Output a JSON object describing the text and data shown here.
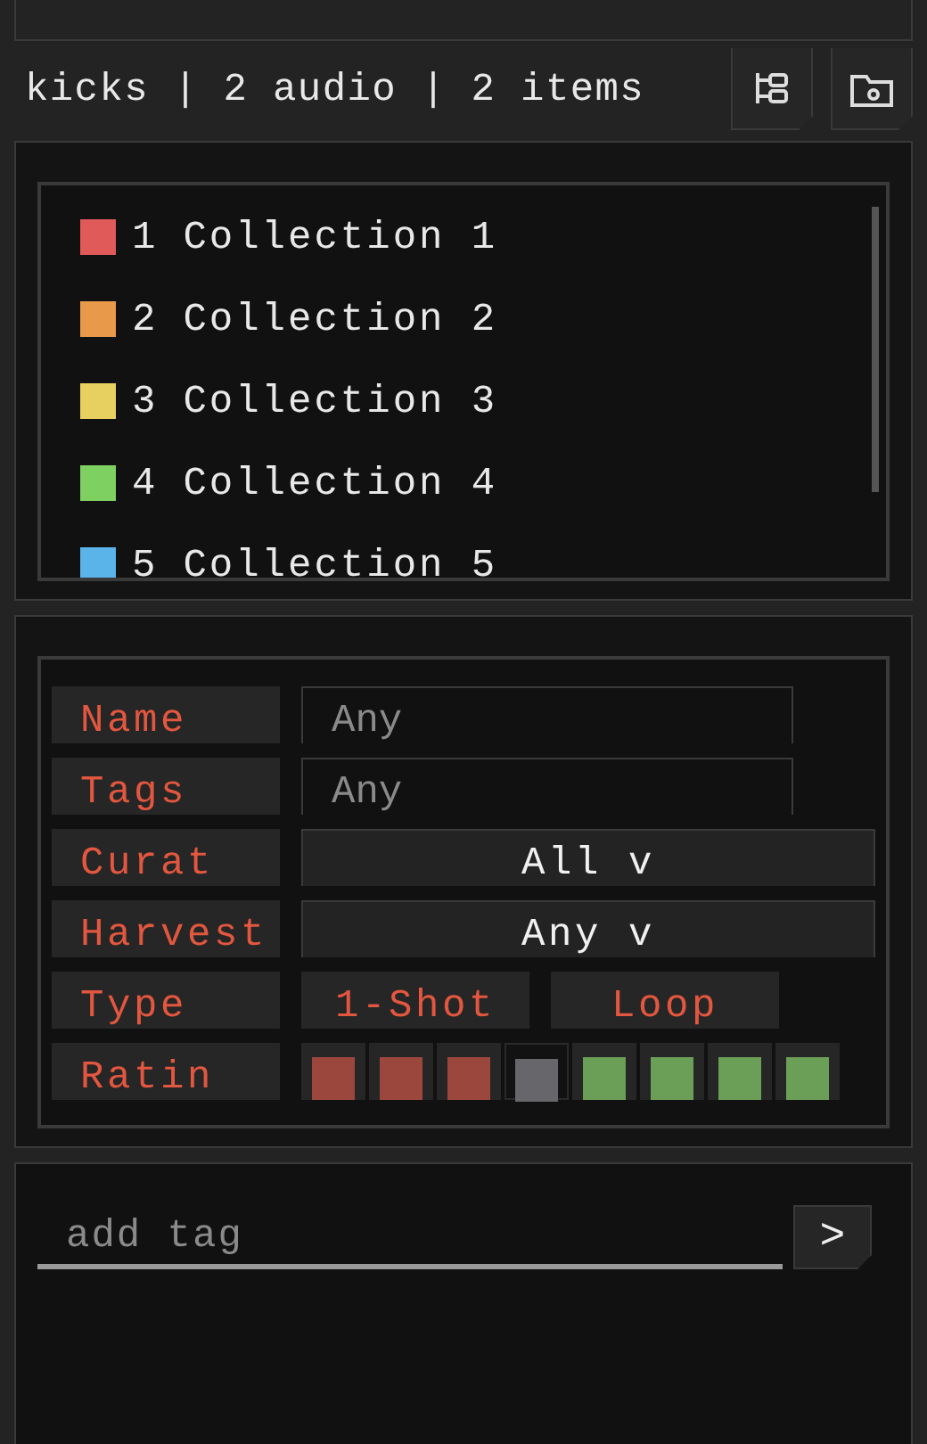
{
  "header": {
    "title": "kicks | 2 audio | 2 items"
  },
  "collections": [
    {
      "number": "1",
      "name": "Collection 1",
      "color": "#e05a5a"
    },
    {
      "number": "2",
      "name": "Collection 2",
      "color": "#e89a4a"
    },
    {
      "number": "3",
      "name": "Collection 3",
      "color": "#e8d060"
    },
    {
      "number": "4",
      "name": "Collection 4",
      "color": "#7ed060"
    },
    {
      "number": "5",
      "name": "Collection 5",
      "color": "#5ab4ea"
    }
  ],
  "filters": [
    {
      "kind": "text",
      "label": "Name",
      "placeholder": "Any"
    },
    {
      "kind": "text",
      "label": "Tags",
      "placeholder": "Any"
    },
    {
      "kind": "dropdown",
      "label": "Curat",
      "value": "All v"
    },
    {
      "kind": "dropdown",
      "label": "Harvest",
      "value": "Any v"
    },
    {
      "kind": "toggles",
      "label": "Type",
      "options": [
        "1-Shot",
        "Loop"
      ]
    },
    {
      "kind": "rating",
      "label": "Ratin",
      "cells": [
        {
          "color": "#9c473e",
          "selected": false
        },
        {
          "color": "#9c473e",
          "selected": false
        },
        {
          "color": "#9c473e",
          "selected": false
        },
        {
          "color": "#67676b",
          "selected": true
        },
        {
          "color": "#6b9e56",
          "selected": false
        },
        {
          "color": "#6b9e56",
          "selected": false
        },
        {
          "color": "#6b9e56",
          "selected": false
        },
        {
          "color": "#6b9e56",
          "selected": false
        }
      ]
    }
  ],
  "tag_entry": {
    "placeholder": "add tag",
    "button": ">"
  }
}
